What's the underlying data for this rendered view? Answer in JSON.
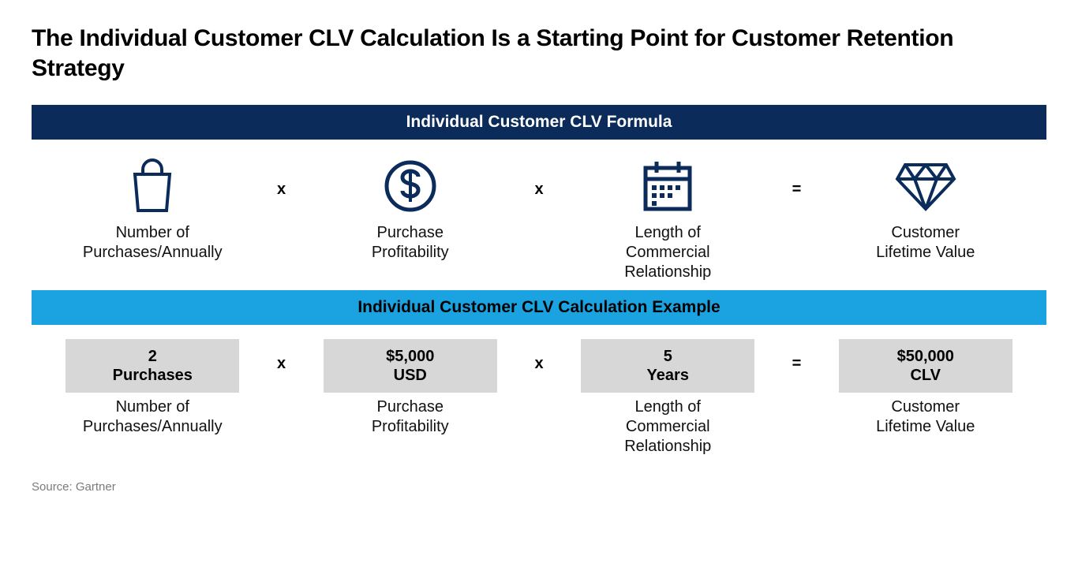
{
  "title": "The Individual Customer CLV Calculation Is a Starting Point for Customer Retention Strategy",
  "formula": {
    "banner": "Individual Customer CLV Formula",
    "items": [
      {
        "label": "Number of\nPurchases/Annually"
      },
      {
        "label": "Purchase\nProfitability"
      },
      {
        "label": "Length of\nCommercial\nRelationship"
      },
      {
        "label": "Customer\nLifetime Value"
      }
    ],
    "ops": [
      "x",
      "x",
      "="
    ]
  },
  "example": {
    "banner": "Individual Customer CLV Calculation Example",
    "items": [
      {
        "value_line1": "2",
        "value_line2": "Purchases",
        "label": "Number of\nPurchases/Annually"
      },
      {
        "value_line1": "$5,000",
        "value_line2": "USD",
        "label": "Purchase\nProfitability"
      },
      {
        "value_line1": "5",
        "value_line2": "Years",
        "label": "Length of\nCommercial\nRelationship"
      },
      {
        "value_line1": "$50,000",
        "value_line2": "CLV",
        "label": "Customer\nLifetime Value"
      }
    ],
    "ops": [
      "x",
      "x",
      "="
    ]
  },
  "source": "Source: Gartner",
  "colors": {
    "darkBanner": "#0b2b5a",
    "lightBanner": "#1aa3e0",
    "iconStroke": "#0b2b5a",
    "valueBox": "#d7d7d7"
  }
}
